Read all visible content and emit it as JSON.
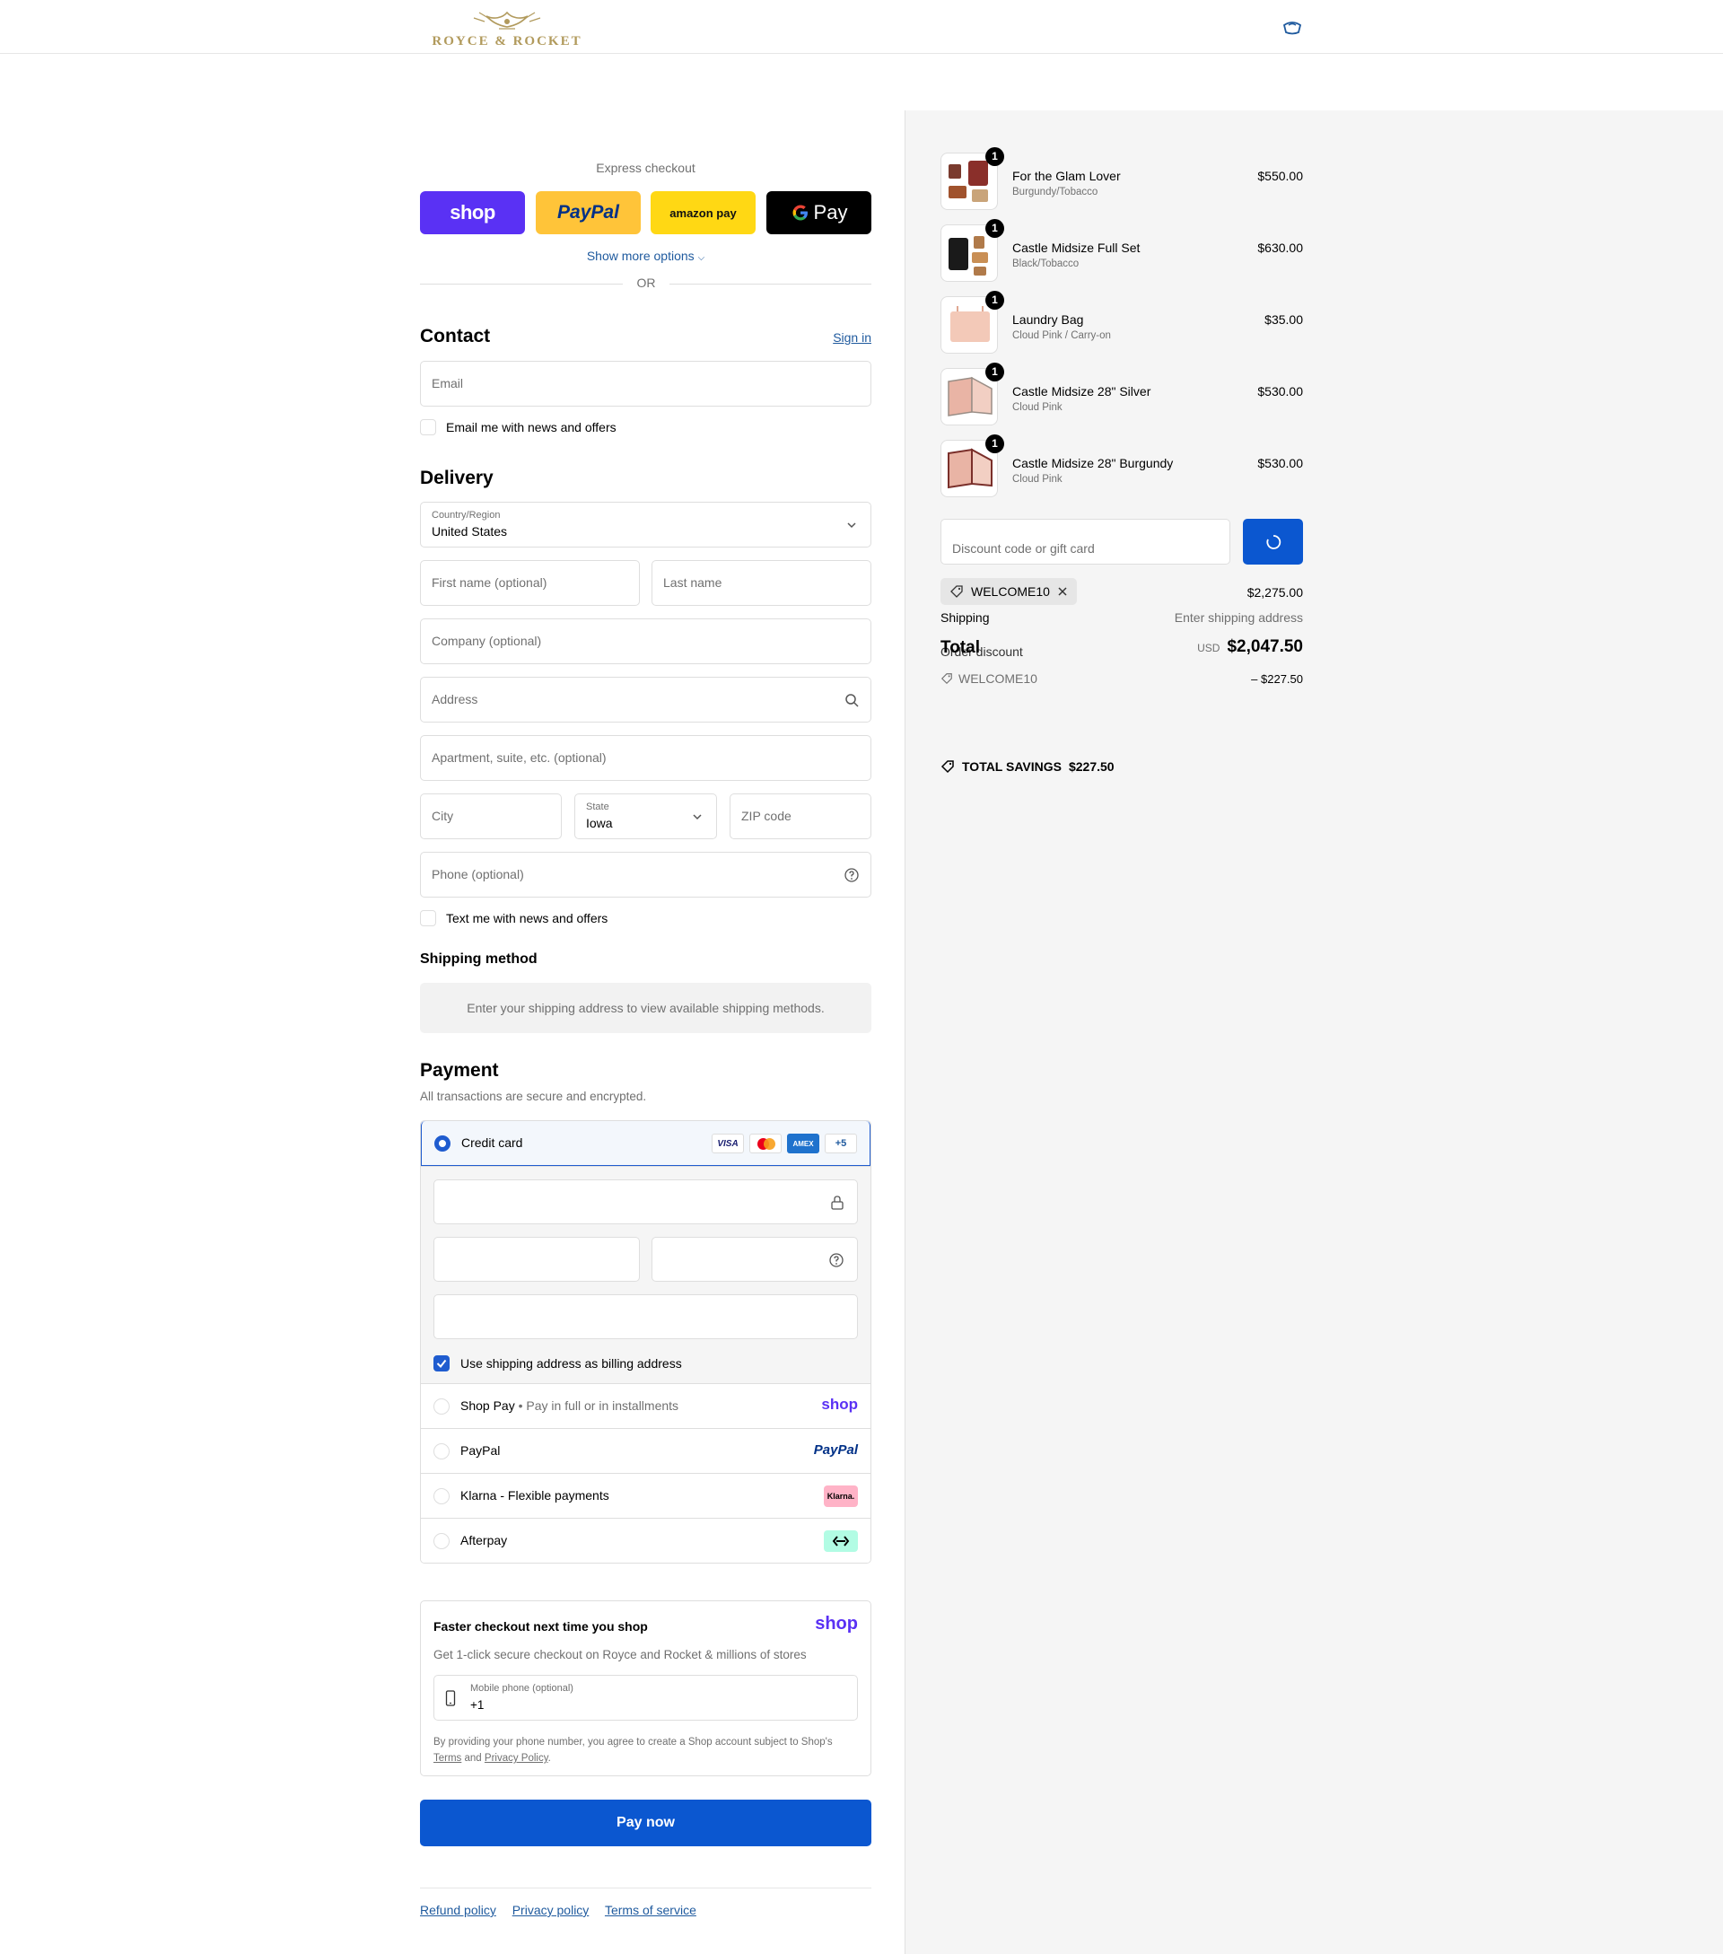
{
  "brand": {
    "name": "ROYCE & ROCKET",
    "color": "#b19a5c"
  },
  "colors": {
    "accent": "#0b57d0",
    "link": "#1f5a9e",
    "muted": "#707070"
  },
  "express": {
    "label": "Express checkout",
    "buttons": [
      {
        "name": "shop",
        "bg": "#5a31f4"
      },
      {
        "name": "PayPal",
        "bg": "#ffc439"
      },
      {
        "name": "amazon pay",
        "bg": "#ffd814"
      },
      {
        "name": "Pay",
        "bg": "#000000"
      }
    ],
    "show_more": "Show more options",
    "or": "OR"
  },
  "contact": {
    "title": "Contact",
    "sign_in": "Sign in",
    "email_placeholder": "Email",
    "newsletter": "Email me with news and offers"
  },
  "delivery": {
    "title": "Delivery",
    "country_label": "Country/Region",
    "country_value": "United States",
    "first_name": "First name (optional)",
    "last_name": "Last name",
    "company": "Company (optional)",
    "address": "Address",
    "apartment": "Apartment, suite, etc. (optional)",
    "city": "City",
    "state_label": "State",
    "state_value": "Iowa",
    "zip": "ZIP code",
    "phone": "Phone (optional)",
    "sms": "Text me with news and offers"
  },
  "shipping": {
    "title": "Shipping method",
    "note": "Enter your shipping address to view available shipping methods."
  },
  "payment": {
    "title": "Payment",
    "subtitle": "All transactions are secure and encrypted.",
    "credit_card": "Credit card",
    "card_brands": [
      "VISA",
      "MC",
      "AMEX"
    ],
    "more_cards": "+5",
    "billing_same": "Use shipping address as billing address",
    "shop_pay": "Shop Pay",
    "shop_pay_sub": "Pay in full or in installments",
    "shop_pay_logo": "shop",
    "paypal": "PayPal",
    "paypal_logo": "PayPal",
    "klarna": "Klarna - Flexible payments",
    "klarna_logo": "Klarna.",
    "afterpay": "Afterpay"
  },
  "faster": {
    "title": "Faster checkout next time you shop",
    "logo": "shop",
    "desc": "Get 1-click secure checkout on Royce and Rocket & millions of stores",
    "phone_label": "Mobile phone (optional)",
    "phone_value": "+1",
    "legal_1": "By providing your phone number, you agree to create a Shop account subject to Shop's",
    "terms": "Terms",
    "and": "and",
    "privacy": "Privacy Policy",
    "period": "."
  },
  "pay_now": "Pay now",
  "footer": [
    "Refund policy",
    "Privacy policy",
    "Terms of service"
  ],
  "cart": {
    "items": [
      {
        "qty": "1",
        "name": "For the Glam Lover",
        "variant": "Burgundy/Tobacco",
        "price": "$550.00"
      },
      {
        "qty": "1",
        "name": "Castle Midsize Full Set",
        "variant": "Black/Tobacco",
        "price": "$630.00"
      },
      {
        "qty": "1",
        "name": "Laundry Bag",
        "variant": "Cloud Pink / Carry-on",
        "price": "$35.00"
      },
      {
        "qty": "1",
        "name": "Castle Midsize 28\" Silver",
        "variant": "Cloud Pink",
        "price": "$530.00"
      },
      {
        "qty": "1",
        "name": "Castle Midsize 28\" Burgundy",
        "variant": "Cloud Pink",
        "price": "$530.00"
      }
    ],
    "discount_placeholder": "Discount code or gift card",
    "applied_code": "WELCOME10",
    "subtotal": "$2,275.00",
    "shipping_label": "Shipping",
    "shipping_value": "Enter shipping address",
    "total_label": "Total",
    "currency": "USD",
    "total": "$2,047.50",
    "order_discount_label": "Order discount",
    "order_discount_code": "WELCOME10",
    "order_discount_value": "– $227.50",
    "savings_label": "TOTAL SAVINGS",
    "savings_value": "$227.50"
  }
}
